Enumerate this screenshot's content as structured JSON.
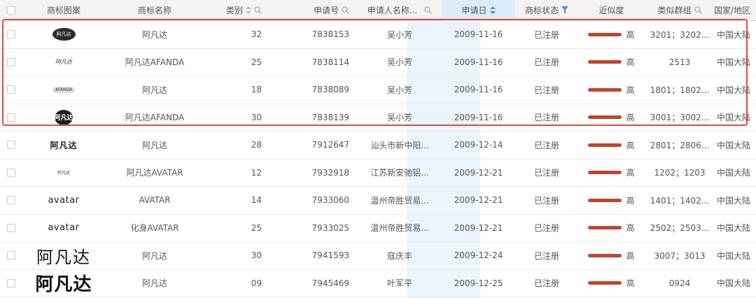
{
  "header": {
    "logo": "商标图案",
    "name": "商标名称",
    "class": "类别",
    "app_no": "申请号",
    "applicant": "申请人名称...",
    "date": "申请日",
    "status": "商标状态",
    "similarity": "近似度",
    "group": "类似群组",
    "country": "国家/地区"
  },
  "colors": {
    "highlight": "#e24a3b",
    "similarity_bar": "#c0452a",
    "date_column_bg": "#eaf4fc",
    "sort_active": "#3f8ef0"
  },
  "rows": [
    {
      "logo_text": "阿凡达",
      "logo_style": "dark-oval",
      "name": "阿凡达",
      "class": "32",
      "app_no": "7838153",
      "applicant": "吴小芳",
      "date": "2009-11-16",
      "status": "已注册",
      "similarity": "高",
      "group": "3201；3202...",
      "country": "中国大陆"
    },
    {
      "logo_text": "阿凡达",
      "logo_style": "script",
      "name": "阿凡达AFANDA",
      "class": "25",
      "app_no": "7838114",
      "applicant": "吴小芳",
      "date": "2009-11-16",
      "status": "已注册",
      "similarity": "高",
      "group": "2513",
      "country": "中国大陆"
    },
    {
      "logo_text": "AFANDA",
      "logo_style": "small-oval",
      "name": "阿凡达",
      "class": "18",
      "app_no": "7838089",
      "applicant": "吴小芳",
      "date": "2009-11-16",
      "status": "已注册",
      "similarity": "高",
      "group": "1801；1802...",
      "country": "中国大陆"
    },
    {
      "logo_text": "阿凡达",
      "logo_style": "round",
      "name": "阿凡达AFANDA",
      "class": "30",
      "app_no": "7838139",
      "applicant": "吴小芳",
      "date": "2009-11-16",
      "status": "已注册",
      "similarity": "高",
      "group": "3001；3002...",
      "country": "中国大陆"
    },
    {
      "logo_text": "阿凡达",
      "logo_style": "bold",
      "name": "阿凡达",
      "class": "28",
      "app_no": "7912647",
      "applicant": "汕头市新中阳...",
      "date": "2009-12-14",
      "status": "已注册",
      "similarity": "高",
      "group": "2801；2806...",
      "country": "中国大陆"
    },
    {
      "logo_text": "阿凡达",
      "logo_style": "tiny",
      "name": "阿凡达AVATAR",
      "class": "12",
      "app_no": "7932918",
      "applicant": "江苏新安驰铝...",
      "date": "2009-12-21",
      "status": "已注册",
      "similarity": "高",
      "group": "1202；1203",
      "country": "中国大陆"
    },
    {
      "logo_text": "avatar",
      "logo_style": "avatar",
      "name": "AVATAR",
      "class": "14",
      "app_no": "7933060",
      "applicant": "温州帝胜贸易...",
      "date": "2009-12-21",
      "status": "已注册",
      "similarity": "高",
      "group": "1401；1402...",
      "country": "中国大陆"
    },
    {
      "logo_text": "avatar",
      "logo_style": "avatar",
      "name": "化身AVATAR",
      "class": "25",
      "app_no": "7933025",
      "applicant": "温州帝胜贸易...",
      "date": "2009-12-21",
      "status": "已注册",
      "similarity": "高",
      "group": "2502；2503...",
      "country": "中国大陆"
    },
    {
      "logo_text": "阿凡达",
      "logo_style": "brush",
      "name": "阿凡达",
      "class": "30",
      "app_no": "7941593",
      "applicant": "寇庆丰",
      "date": "2009-12-24",
      "status": "已注册",
      "similarity": "高",
      "group": "3007；3013",
      "country": "中国大陆"
    },
    {
      "logo_text": "阿凡达",
      "logo_style": "brush-bold",
      "name": "阿凡达",
      "class": "09",
      "app_no": "7945469",
      "applicant": "叶军平",
      "date": "2009-12-25",
      "status": "已注册",
      "similarity": "高",
      "group": "0924",
      "country": "中国大陆"
    }
  ]
}
